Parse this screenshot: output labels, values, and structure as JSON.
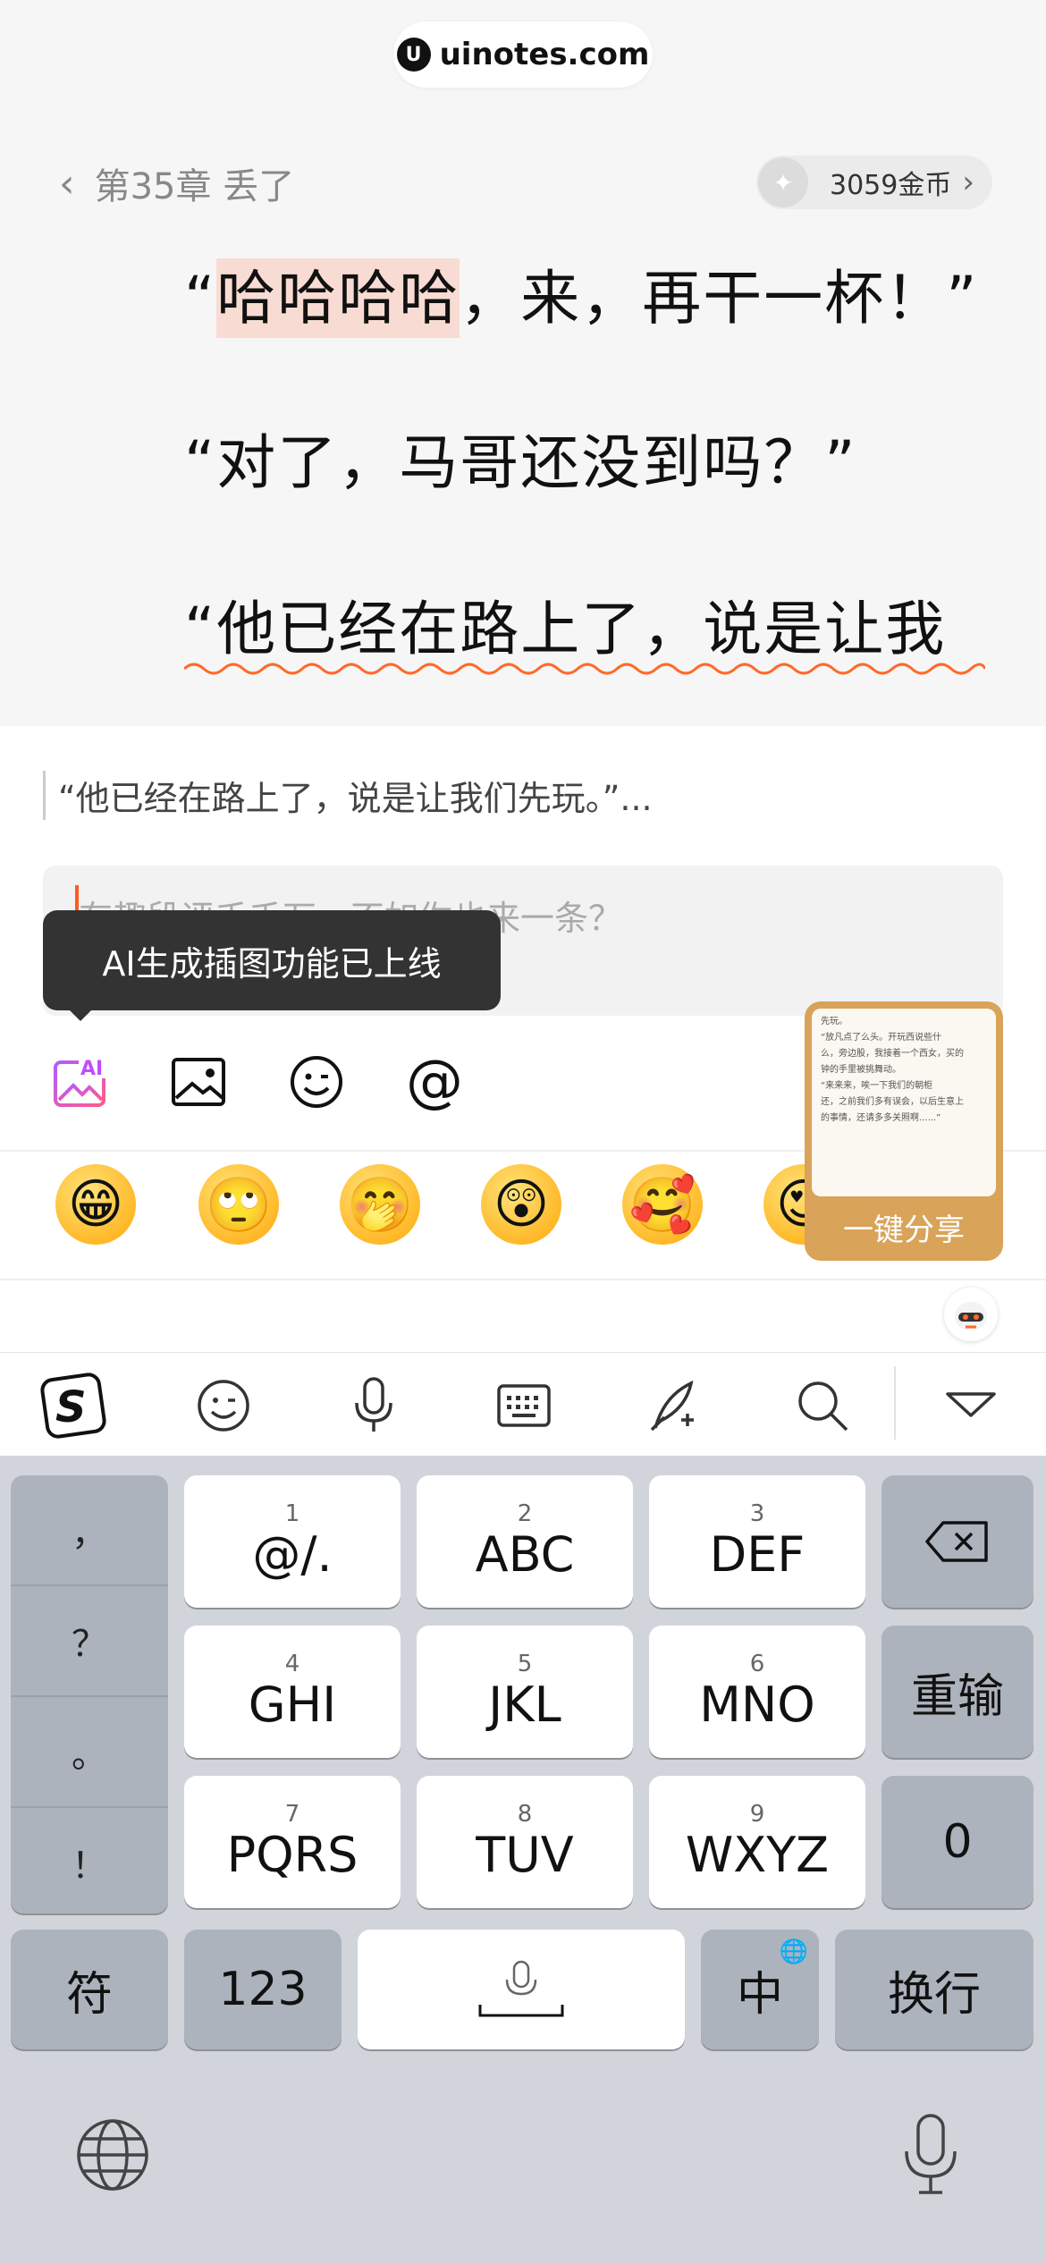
{
  "watermark": {
    "text": "uinotes.com"
  },
  "header": {
    "chapter": "第35章 丢了",
    "coins": "3059金币"
  },
  "reading": {
    "line1_open": "“",
    "line1_highlight": "哈哈哈哈",
    "line1_rest": "，来，再干一杯！”",
    "line2": "“对了，马哥还没到吗？”",
    "line3": "“他已经在路上了，说是让我"
  },
  "comment": {
    "quote": "“他已经在路上了，说是让我们先玩。”...",
    "placeholder": "有趣段评千千万，不如你也来一条？",
    "tooltip": "AI生成插图功能已上线",
    "tools": [
      "ai-image-icon",
      "image-icon",
      "emoji-icon",
      "mention-icon"
    ]
  },
  "emojis": [
    "grinning-face",
    "rolling-eyes-face",
    "hand-over-mouth-face",
    "confused-face",
    "blushing-face",
    "heart-eyes-face"
  ],
  "share_card": {
    "label": "一键分享",
    "text_lines": [
      "先玩。",
      "“放凡点了么头。开玩西说些什",
      "么，旁边股，我接着一个西女，买的",
      "钟的手里被挑舞动。",
      "“来来来，唉一下我们的朝柜",
      "还，之前我们多有误会，以后生意上",
      "的事情，还请多多关照啊......”"
    ]
  },
  "ime_toolbar": [
    "sogou-logo-icon",
    "emoji-icon",
    "microphone-icon",
    "keyboard-icon",
    "handwriting-icon",
    "search-icon",
    "collapse-icon"
  ],
  "keyboard": {
    "punct": [
      "，",
      "？",
      "。",
      "！"
    ],
    "rows": [
      [
        {
          "num": "1",
          "label": "@/."
        },
        {
          "num": "2",
          "label": "ABC"
        },
        {
          "num": "3",
          "label": "DEF"
        }
      ],
      [
        {
          "num": "4",
          "label": "GHI"
        },
        {
          "num": "5",
          "label": "JKL"
        },
        {
          "num": "6",
          "label": "MNO"
        }
      ],
      [
        {
          "num": "7",
          "label": "PQRS"
        },
        {
          "num": "8",
          "label": "TUV"
        },
        {
          "num": "9",
          "label": "WXYZ"
        }
      ]
    ],
    "reenter": "重输",
    "zero": "0",
    "symbols": "符",
    "numbers": "123",
    "lang": "中",
    "enter": "换行"
  }
}
